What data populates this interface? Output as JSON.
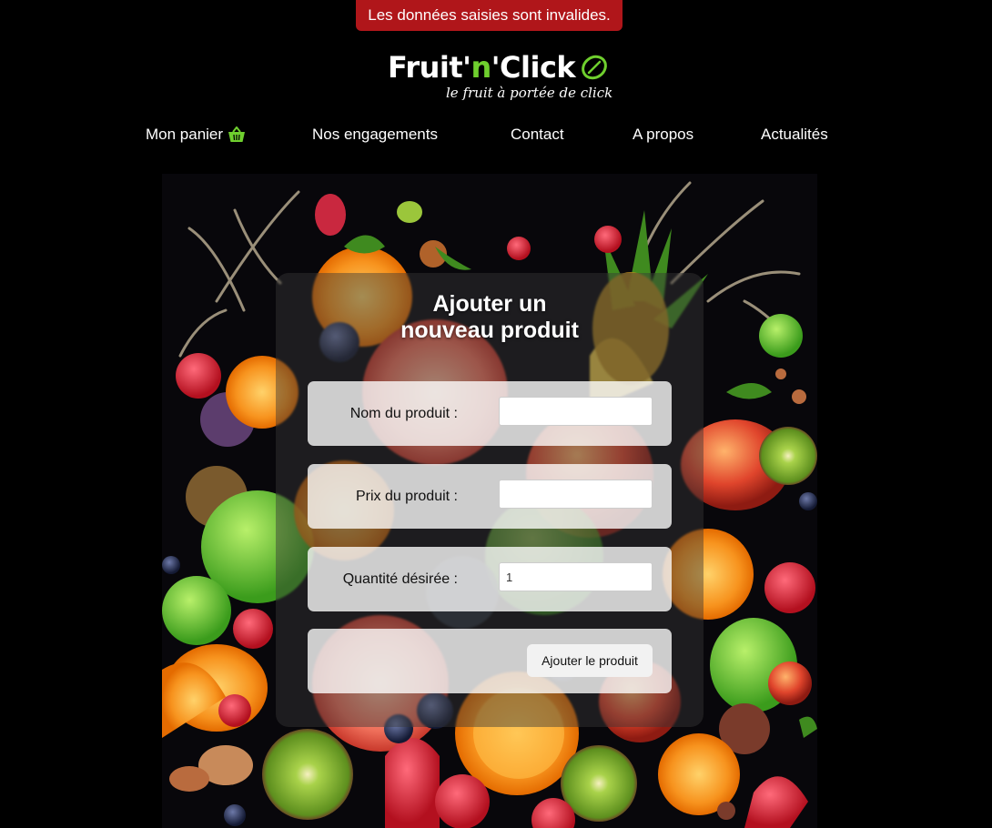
{
  "alert": {
    "message": "Les données saisies sont invalides.",
    "color": "#b0161a"
  },
  "brand": {
    "name_part1": "Fruit'",
    "name_part2": "n",
    "name_part3": "'Click",
    "tagline": "le fruit à portée de click",
    "accent": "#6fcf2e",
    "logo_icon": "leaf-icon"
  },
  "nav": {
    "items": [
      {
        "label": "Mon panier",
        "icon": "basket-icon"
      },
      {
        "label": "Nos engagements"
      },
      {
        "label": "Contact"
      },
      {
        "label": "A propos"
      },
      {
        "label": "Actualités"
      }
    ]
  },
  "form": {
    "title_line1": "Ajouter un",
    "title_line2": "nouveau produit",
    "fields": [
      {
        "label": "Nom du produit :",
        "value": ""
      },
      {
        "label": "Prix du produit :",
        "value": ""
      },
      {
        "label": "Quantité désirée :",
        "value": "1"
      }
    ],
    "submit_label": "Ajouter le produit"
  }
}
